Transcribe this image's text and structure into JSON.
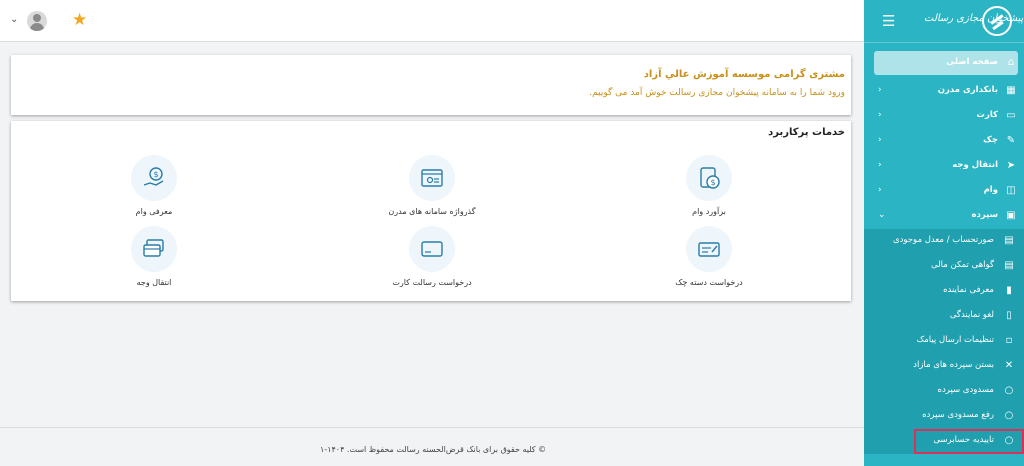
{
  "header": {
    "star_icon": "star-icon",
    "avatar_icon": "user-avatar-icon",
    "dropdown_icon": "chevron-down-icon"
  },
  "welcome": {
    "line1": "مشتری گرامی موسسه آموزش عالي آزاد",
    "line2": "ورود شما را به سامانه پیشخوان مجازی رسالت خوش آمد می گوییم."
  },
  "services": {
    "title": "خدمات پرکاربرد",
    "items": [
      {
        "label": "برآورد وام",
        "icon": "loan-estimate-icon"
      },
      {
        "label": "گذرواژه سامانه های مدرن",
        "icon": "password-icon"
      },
      {
        "label": "معرفی وام",
        "icon": "loan-intro-icon"
      },
      {
        "label": "درخواست دسته چک",
        "icon": "checkbook-icon"
      },
      {
        "label": "درخواست رسالت کارت",
        "icon": "card-icon"
      },
      {
        "label": "انتقال وجه",
        "icon": "transfer-icon"
      }
    ]
  },
  "footer": {
    "text": "© کلیه حقوق برای بانک قرض‌الحسنه رسالت محفوظ است. ۱۴۰۴-۱"
  },
  "sidebar": {
    "brand": "پیشخوان مجازی رسالت",
    "items": [
      {
        "label": "صفحه اصلی",
        "icon": "home-icon"
      },
      {
        "label": "بانکداری مدرن",
        "icon": "bank-icon"
      },
      {
        "label": "کارت",
        "icon": "card-icon"
      },
      {
        "label": "چک",
        "icon": "check-icon"
      },
      {
        "label": "انتقال وجه",
        "icon": "send-icon"
      },
      {
        "label": "وام",
        "icon": "loan-icon"
      },
      {
        "label": "سپرده",
        "icon": "deposit-icon"
      }
    ],
    "sub_items": [
      {
        "label": "صورتحساب / معدل موجودی",
        "icon": "statement-icon"
      },
      {
        "label": "گواهی تمکن مالی",
        "icon": "certificate-icon"
      },
      {
        "label": "معرفی نماینده",
        "icon": "bookmark-icon"
      },
      {
        "label": "لغو نمایندگی",
        "icon": "bookmark-outline-icon"
      },
      {
        "label": "تنظیمات ارسال پیامک",
        "icon": "sms-icon"
      },
      {
        "label": "بستن سپرده های مازاد",
        "icon": "close-icon"
      },
      {
        "label": "مسدودی سپرده",
        "icon": "lock-icon"
      },
      {
        "label": "رفع مسدودی سپرده",
        "icon": "unlock-icon"
      },
      {
        "label": "تاییدیه حسابرسی",
        "icon": "lock-icon"
      }
    ]
  }
}
